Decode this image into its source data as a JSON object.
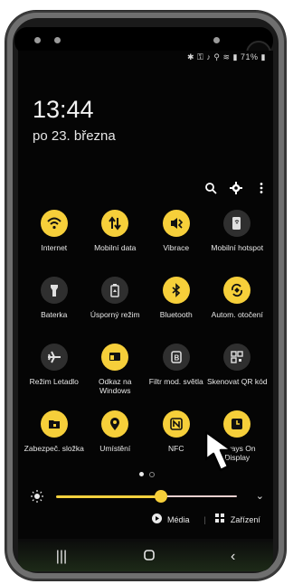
{
  "status_bar": {
    "battery_text": "71%"
  },
  "clock": {
    "time": "13:44",
    "date": "po 23. března"
  },
  "tiles": [
    {
      "label": "Internet",
      "icon": "wifi-icon",
      "state": "on"
    },
    {
      "label": "Mobilní data",
      "icon": "mobile-data-icon",
      "state": "on"
    },
    {
      "label": "Vibrace",
      "icon": "vibrate-icon",
      "state": "on"
    },
    {
      "label": "Mobilní hotspot",
      "icon": "hotspot-icon",
      "state": "off"
    },
    {
      "label": "Baterka",
      "icon": "flashlight-icon",
      "state": "off"
    },
    {
      "label": "Úsporný režim",
      "icon": "battery-saver-icon",
      "state": "off"
    },
    {
      "label": "Bluetooth",
      "icon": "bluetooth-icon",
      "state": "on"
    },
    {
      "label": "Autom. otočení",
      "icon": "auto-rotate-icon",
      "state": "on"
    },
    {
      "label": "Režim Letadlo",
      "icon": "airplane-icon",
      "state": "off"
    },
    {
      "label": "Odkaz na Windows",
      "icon": "link-to-windows-icon",
      "state": "on"
    },
    {
      "label": "Filtr mod. světla",
      "icon": "blue-light-filter-icon",
      "state": "off"
    },
    {
      "label": "Skenovat QR kód",
      "icon": "qr-scan-icon",
      "state": "off"
    },
    {
      "label": "Zabezpeč. složka",
      "icon": "secure-folder-icon",
      "state": "on"
    },
    {
      "label": "Umístění",
      "icon": "location-icon",
      "state": "on"
    },
    {
      "label": "NFC",
      "icon": "nfc-icon",
      "state": "on"
    },
    {
      "label": "Always On Display",
      "icon": "always-on-display-icon",
      "state": "on"
    }
  ],
  "brightness": {
    "level": 0.57
  },
  "media": {
    "media_label": "Média",
    "devices_label": "Zařízení"
  },
  "colors": {
    "accent": "#f6cf3a",
    "tile_off": "#2f2f2f",
    "background": "#050505"
  }
}
